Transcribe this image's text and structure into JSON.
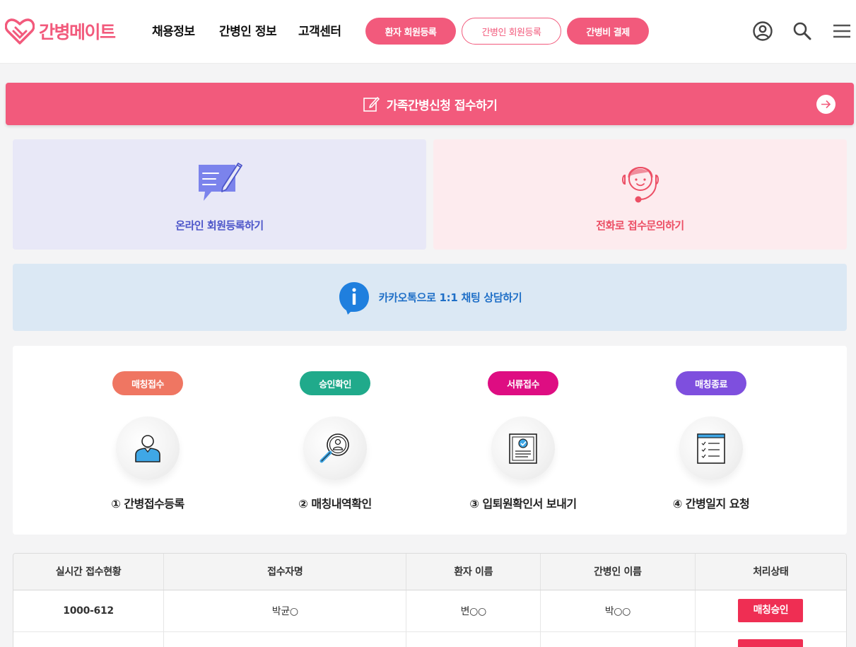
{
  "brand": {
    "name": "간병메이트",
    "color": "#f25a7c"
  },
  "nav": [
    {
      "label": "채용정보"
    },
    {
      "label": "간병인 정보"
    },
    {
      "label": "고객센터"
    }
  ],
  "header_buttons": [
    {
      "label": "환자 회원등록",
      "style": "filled"
    },
    {
      "label": "간병인 회원등록",
      "style": "outline"
    },
    {
      "label": "간병비 결제",
      "style": "filled"
    }
  ],
  "header_icons": [
    "user-circle-icon",
    "search-icon",
    "menu-icon"
  ],
  "apply_banner": {
    "label": "가족간병신청 접수하기",
    "icon": "edit-icon",
    "action_icon": "arrow-right-icon"
  },
  "cards": {
    "online": {
      "label": "온라인 회원등록하기",
      "icon": "chat-pencil-icon"
    },
    "phone": {
      "label": "전화로 접수문의하기",
      "icon": "headset-agent-icon"
    },
    "kakao": {
      "label": "카카오톡으로 1:1 채팅 상담하기",
      "icon": "info-bubble-icon"
    }
  },
  "steps": [
    {
      "badge": "매칭접수",
      "badge_color": "#ef7662",
      "label": "① 간병접수등록",
      "icon": "person-icon"
    },
    {
      "badge": "승인확인",
      "badge_color": "#20aa8b",
      "label": "② 매칭내역확인",
      "icon": "magnifier-person-icon"
    },
    {
      "badge": "서류접수",
      "badge_color": "#de0d82",
      "label": "③ 입퇴원확인서 보내기",
      "icon": "document-check-icon"
    },
    {
      "badge": "매칭종료",
      "badge_color": "#7e4fde",
      "label": "④ 간병일지 요청",
      "icon": "checklist-icon"
    }
  ],
  "table": {
    "headers": [
      "실시간 접수현황",
      "접수자명",
      "환자 이름",
      "간병인 이름",
      "처리상태"
    ],
    "rows": [
      {
        "code": "1000-612",
        "applicant": "박균○",
        "patient": "변○○",
        "caregiver": "박○○",
        "status": "매칭승인"
      },
      {
        "code": "",
        "applicant": "",
        "patient": "",
        "caregiver": "",
        "status": ""
      }
    ]
  }
}
